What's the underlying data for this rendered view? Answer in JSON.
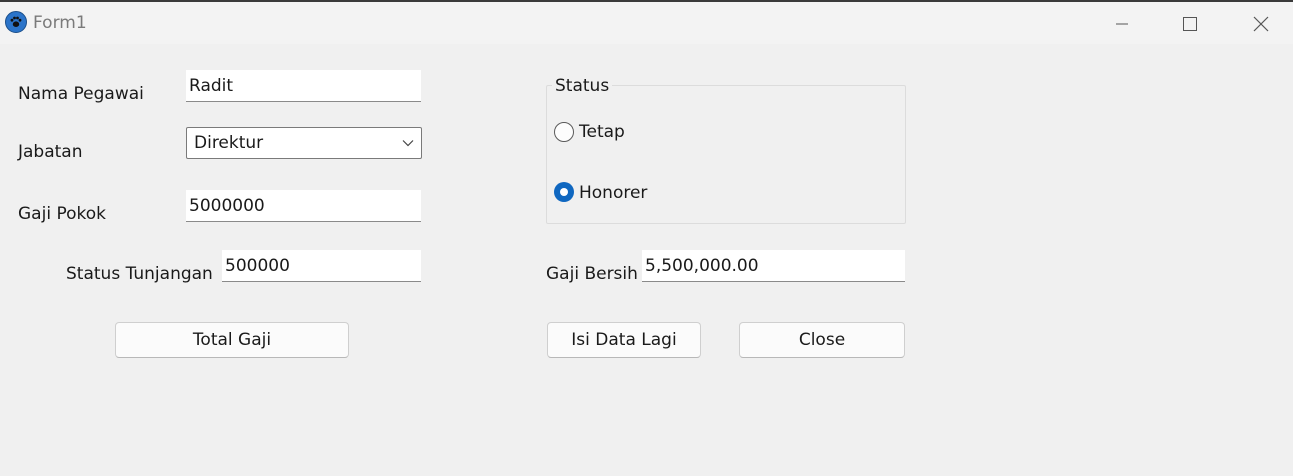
{
  "window": {
    "title": "Form1",
    "icon": "paw-icon",
    "controls": [
      "minimize-icon",
      "maximize-icon",
      "close-icon"
    ]
  },
  "form": {
    "nama_pegawai": {
      "label": "Nama Pegawai",
      "value": "Radit"
    },
    "jabatan": {
      "label": "Jabatan",
      "value": "Direktur"
    },
    "gaji_pokok": {
      "label": "Gaji Pokok",
      "value": "5000000"
    },
    "status_tunjangan": {
      "label": "Status Tunjangan",
      "value": "500000"
    },
    "status": {
      "title": "Status",
      "options": [
        {
          "label": "Tetap",
          "checked": false
        },
        {
          "label": "Honorer",
          "checked": true
        }
      ]
    },
    "gaji_bersih": {
      "label": "Gaji Bersih",
      "value": "5,500,000.00"
    }
  },
  "buttons": {
    "total_gaji": "Total Gaji",
    "isi_data_lagi": "Isi Data Lagi",
    "close": "Close"
  },
  "colors": {
    "accent": "#0f67c0",
    "background": "#f0f0f0"
  }
}
